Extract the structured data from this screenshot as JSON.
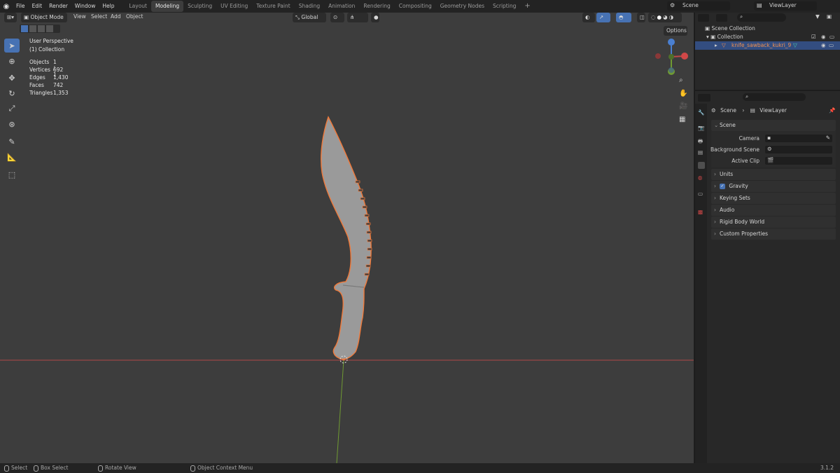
{
  "menus": [
    "File",
    "Edit",
    "Render",
    "Window",
    "Help"
  ],
  "workspaces": [
    "Layout",
    "Modeling",
    "Sculpting",
    "UV Editing",
    "Texture Paint",
    "Shading",
    "Animation",
    "Rendering",
    "Compositing",
    "Geometry Nodes",
    "Scripting"
  ],
  "active_workspace": "Modeling",
  "scene_name": "Scene",
  "view_layer_name": "ViewLayer",
  "viewport": {
    "mode": "Object Mode",
    "header_menus": [
      "View",
      "Select",
      "Add",
      "Object"
    ],
    "orientation": "Global",
    "options_label": "Options",
    "overlay_title": "User Perspective",
    "overlay_collection": "(1) Collection",
    "stats": [
      {
        "label": "Objects",
        "value": "1 / 1"
      },
      {
        "label": "Vertices",
        "value": "692"
      },
      {
        "label": "Edges",
        "value": "1,430"
      },
      {
        "label": "Faces",
        "value": "742"
      },
      {
        "label": "Triangles",
        "value": "1,353"
      }
    ]
  },
  "outliner": {
    "root": "Scene Collection",
    "collection": "Collection",
    "object": "knife_sawback_kukri_9"
  },
  "properties": {
    "breadcrumb_scene": "Scene",
    "breadcrumb_layer": "ViewLayer",
    "scene_panel": "Scene",
    "fields": [
      {
        "label": "Camera"
      },
      {
        "label": "Background Scene"
      },
      {
        "label": "Active Clip"
      }
    ],
    "panels": [
      "Units",
      "Gravity",
      "Keying Sets",
      "Audio",
      "Rigid Body World",
      "Custom Properties"
    ],
    "gravity_checked": true
  },
  "statusbar": {
    "items": [
      "Select",
      "Box Select",
      "Rotate View",
      "Object Context Menu"
    ],
    "version": "3.1.2"
  },
  "colors": {
    "selection": "#f07a3b",
    "x_axis": "#c04a4a",
    "y_axis": "#7fa43a",
    "active": "#4772b3"
  }
}
